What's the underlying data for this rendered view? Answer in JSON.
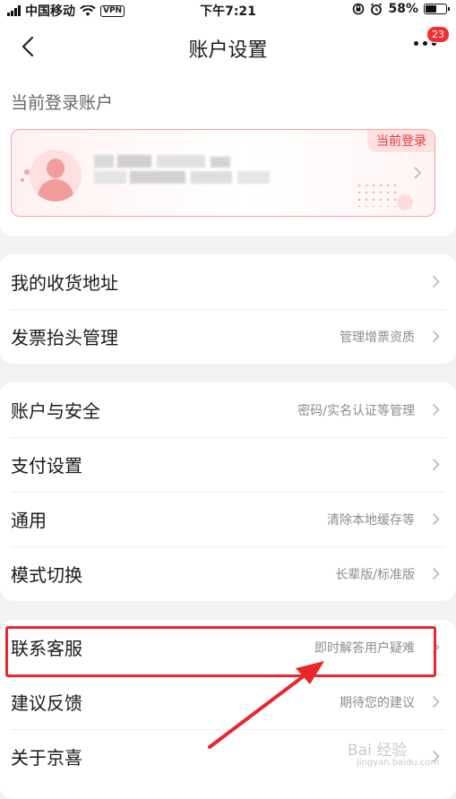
{
  "status_bar": {
    "carrier": "中国移动",
    "vpn": "VPN",
    "time": "下午7:21",
    "battery": "58%",
    "battery_level": 0.58
  },
  "nav": {
    "title": "账户设置",
    "badge_count": "23"
  },
  "account": {
    "section_title": "当前登录账户",
    "current_tag": "当前登录"
  },
  "groups": [
    {
      "rows": [
        {
          "label": "我的收货地址",
          "hint": ""
        },
        {
          "label": "发票抬头管理",
          "hint": "管理增票资质"
        }
      ]
    },
    {
      "rows": [
        {
          "label": "账户与安全",
          "hint": "密码/实名认证等管理"
        },
        {
          "label": "支付设置",
          "hint": ""
        },
        {
          "label": "通用",
          "hint": "清除本地缓存等"
        },
        {
          "label": "模式切换",
          "hint": "长辈版/标准版"
        }
      ]
    },
    {
      "rows": [
        {
          "label": "联系客服",
          "hint": "即时解答用户疑难"
        },
        {
          "label": "建议反馈",
          "hint": "期待您的建议"
        },
        {
          "label": "关于京喜",
          "hint": ""
        }
      ]
    }
  ],
  "watermark": {
    "text": "Bai 经验",
    "sub": "jingyan.baidu.com"
  },
  "colors": {
    "accent": "#e8383d",
    "annotation": "#e8262b",
    "badge": "#f23030"
  }
}
